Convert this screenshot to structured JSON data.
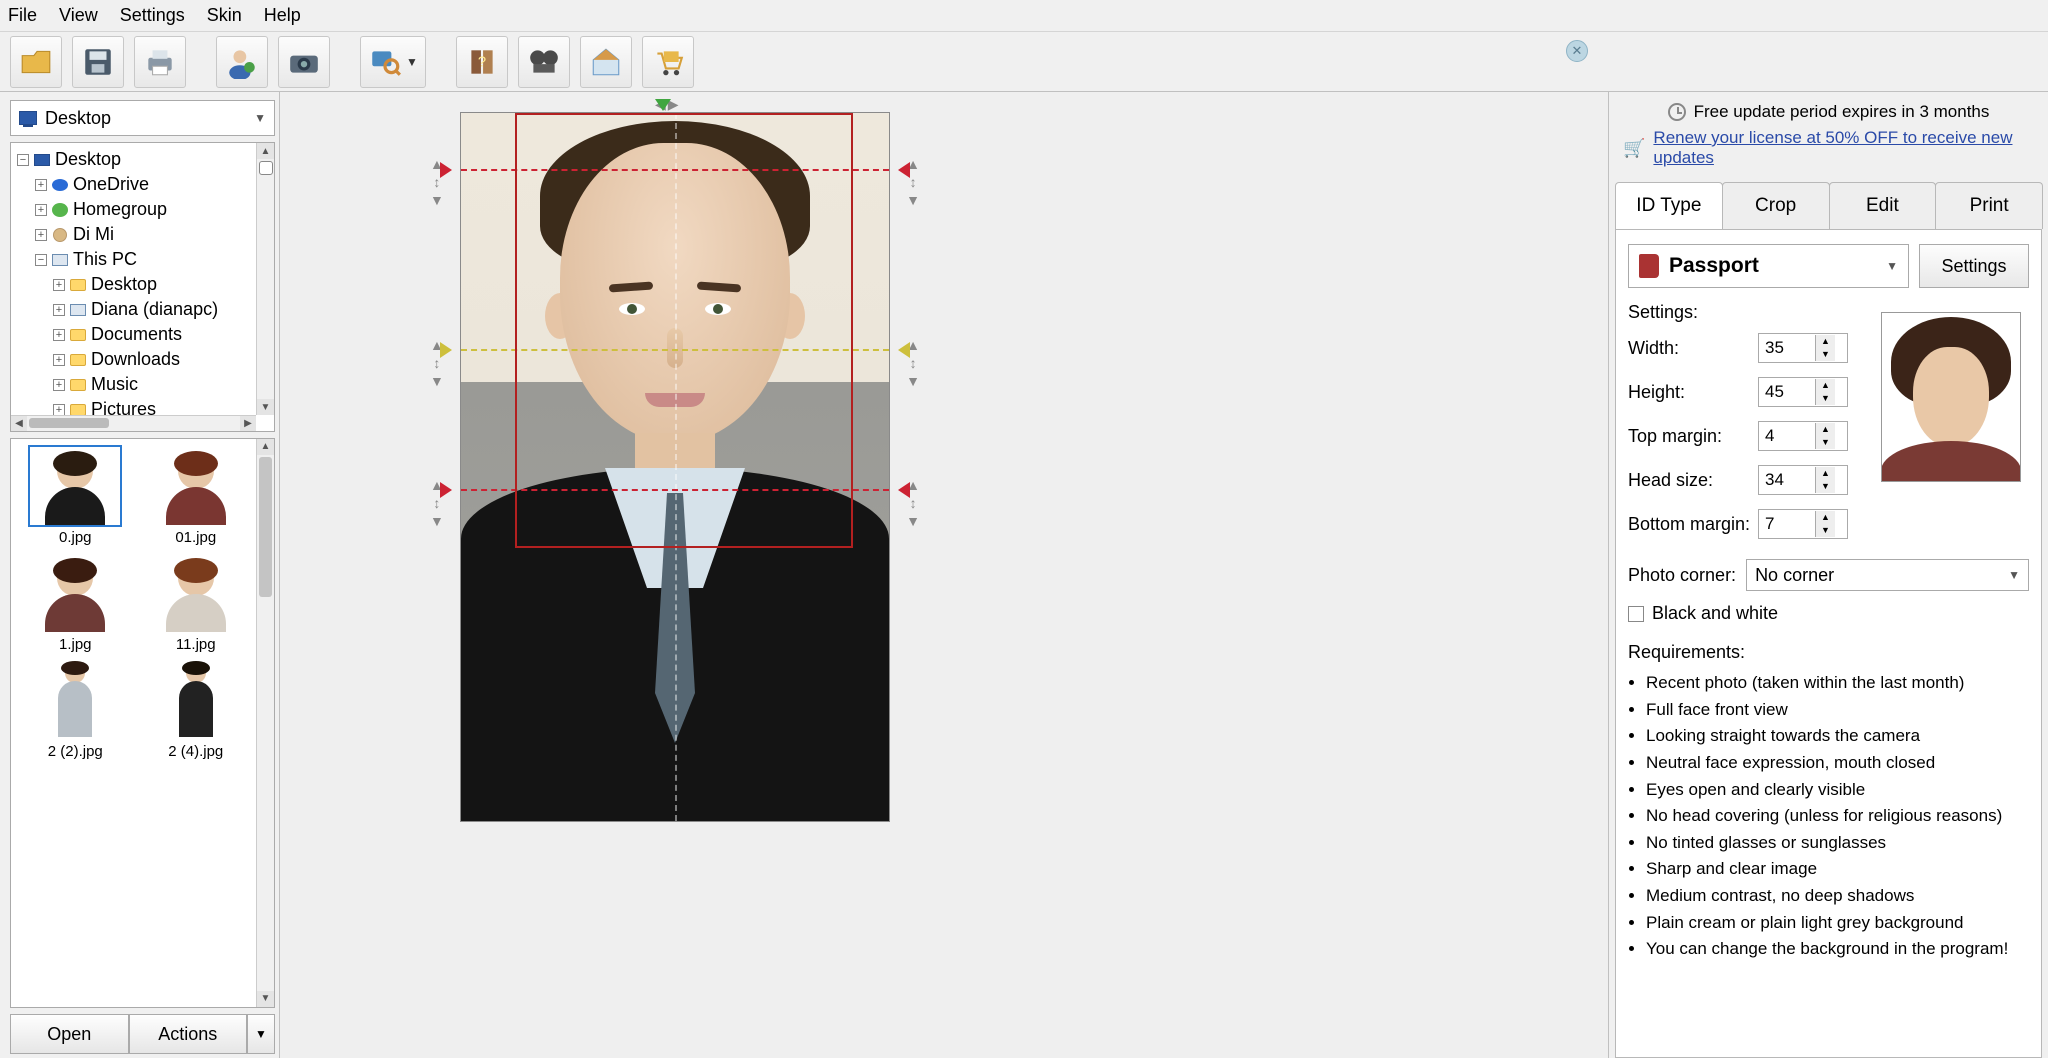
{
  "menu": {
    "file": "File",
    "view": "View",
    "settings": "Settings",
    "skin": "Skin",
    "help": "Help"
  },
  "banner": {
    "line1": "Free update period expires in 3 months",
    "line2": "Renew your license at 50% OFF to receive new updates"
  },
  "path": "Desktop",
  "tree": {
    "root": "Desktop",
    "items": [
      {
        "label": "OneDrive",
        "icon": "cloud",
        "exp": "+",
        "indent": 1
      },
      {
        "label": "Homegroup",
        "icon": "group",
        "exp": "+",
        "indent": 1
      },
      {
        "label": "Di Mi",
        "icon": "user",
        "exp": "+",
        "indent": 1
      },
      {
        "label": "This PC",
        "icon": "pc",
        "exp": "−",
        "indent": 1
      },
      {
        "label": "Desktop",
        "icon": "folder",
        "exp": "+",
        "indent": 2
      },
      {
        "label": "Diana (dianapc)",
        "icon": "pc",
        "exp": "+",
        "indent": 2
      },
      {
        "label": "Documents",
        "icon": "folder",
        "exp": "+",
        "indent": 2
      },
      {
        "label": "Downloads",
        "icon": "folder",
        "exp": "+",
        "indent": 2
      },
      {
        "label": "Music",
        "icon": "folder",
        "exp": "+",
        "indent": 2
      },
      {
        "label": "Pictures",
        "icon": "folder",
        "exp": "+",
        "indent": 2
      }
    ]
  },
  "thumbs": [
    {
      "cap": "0.jpg",
      "sel": true,
      "body": "#1a1a1a"
    },
    {
      "cap": "01.jpg",
      "sel": false,
      "body": "#7a3631",
      "hair": "#6d2e19"
    },
    {
      "cap": "1.jpg",
      "sel": false,
      "body": "#6e3a36",
      "hair": "#3a1c10"
    },
    {
      "cap": "11.jpg",
      "sel": false,
      "body": "#d6cfc5",
      "hair": "#7a3b1c"
    },
    {
      "cap": "2 (2).jpg",
      "sel": false,
      "body": "#b7bfc6",
      "hair": "#2d1a10",
      "full": true
    },
    {
      "cap": "2 (4).jpg",
      "sel": false,
      "body": "#222",
      "hair": "#1a1208",
      "full": true
    }
  ],
  "buttons": {
    "open": "Open",
    "actions": "Actions"
  },
  "tabs": {
    "idtype": "ID Type",
    "crop": "Crop",
    "edit": "Edit",
    "print": "Print"
  },
  "idtype": {
    "name": "Passport",
    "settings_btn": "Settings"
  },
  "settings": {
    "title": "Settings:",
    "width_label": "Width:",
    "width": "35",
    "height_label": "Height:",
    "height": "45",
    "top_label": "Top margin:",
    "top": "4",
    "head_label": "Head size:",
    "head": "34",
    "bottom_label": "Bottom margin:",
    "bottom": "7"
  },
  "corner": {
    "label": "Photo corner:",
    "value": "No corner"
  },
  "bw_label": "Black and white",
  "req_title": "Requirements:",
  "reqs": [
    "Recent photo (taken within the last month)",
    "Full face front view",
    "Looking straight towards the camera",
    "Neutral face expression, mouth closed",
    "Eyes open and clearly visible",
    "No head covering (unless for religious reasons)",
    "No tinted glasses or sunglasses",
    "Sharp and clear image",
    "Medium contrast, no deep shadows",
    "Plain cream or plain light grey background",
    "You can change the background in the program!"
  ]
}
